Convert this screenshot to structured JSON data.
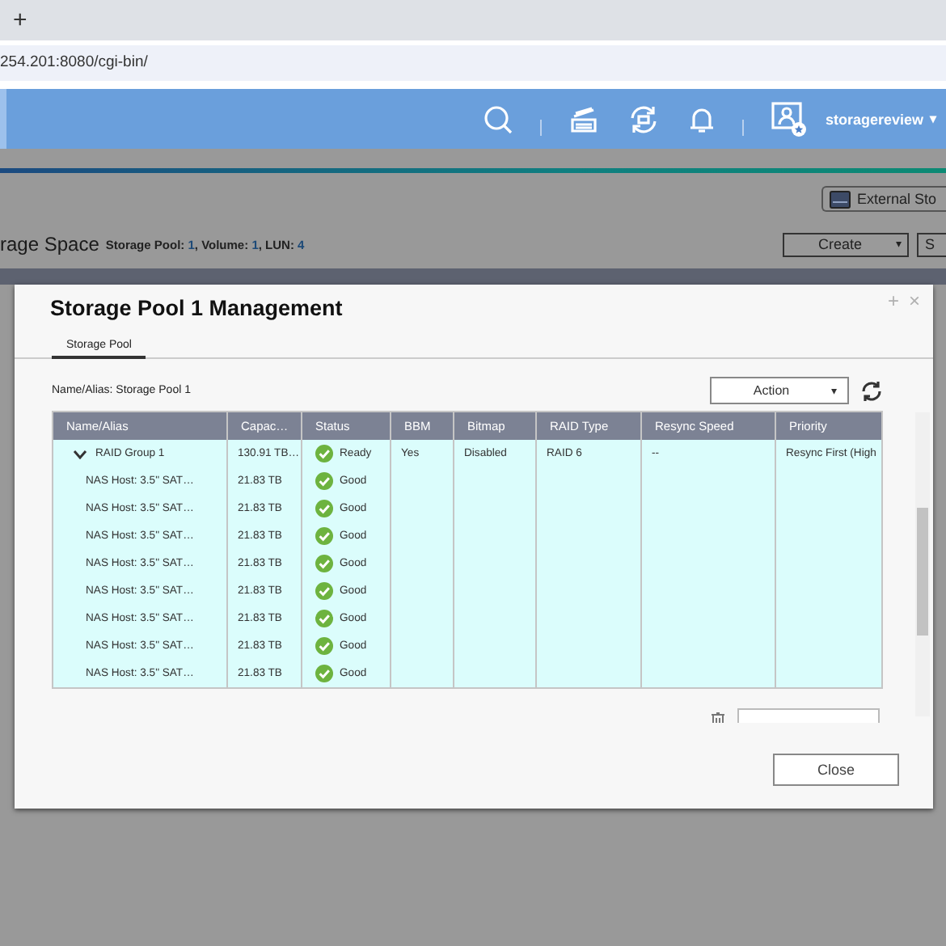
{
  "browser": {
    "new_tab": "+",
    "address": "254.201:8080/cgi-bin/"
  },
  "header": {
    "username": "storagereview",
    "menu_caret": "▾"
  },
  "background": {
    "external_button": "External Sto",
    "page_title": "rage Space",
    "summary": [
      {
        "label": "Storage Pool: ",
        "value": "1"
      },
      {
        "label": ", Volume: ",
        "value": "1"
      },
      {
        "label": ", LUN: ",
        "value": "4"
      }
    ],
    "create_button": "Create",
    "caret": "▾",
    "second_button": "S"
  },
  "dialog": {
    "title": "Storage Pool 1 Management",
    "controls": [
      "+",
      "×"
    ],
    "tabs": [
      {
        "label": "Storage Pool",
        "selected": true
      }
    ],
    "name_alias": "Name/Alias: Storage Pool 1",
    "action": "Action",
    "action_caret": "▾",
    "columns": [
      "Name/Alias",
      "Capac…",
      "Status",
      "BBM",
      "Bitmap",
      "RAID Type",
      "Resync Speed",
      "Priority"
    ],
    "rows": [
      {
        "name": "RAID Group 1",
        "capacity": "130.91 TB…",
        "status": "Ready",
        "bbm": "Yes",
        "bitmap": "Disabled",
        "raid_type": "RAID 6",
        "resync_speed": "--",
        "priority": "Resync First (High",
        "expanded": true,
        "children": [
          {
            "name": "NAS Host: 3.5\" SAT…",
            "capacity": "21.83 TB",
            "status": "Good"
          },
          {
            "name": "NAS Host: 3.5\" SAT…",
            "capacity": "21.83 TB",
            "status": "Good"
          },
          {
            "name": "NAS Host: 3.5\" SAT…",
            "capacity": "21.83 TB",
            "status": "Good"
          },
          {
            "name": "NAS Host: 3.5\" SAT…",
            "capacity": "21.83 TB",
            "status": "Good"
          },
          {
            "name": "NAS Host: 3.5\" SAT…",
            "capacity": "21.83 TB",
            "status": "Good"
          },
          {
            "name": "NAS Host: 3.5\" SAT…",
            "capacity": "21.83 TB",
            "status": "Good"
          },
          {
            "name": "NAS Host: 3.5\" SAT…",
            "capacity": "21.83 TB",
            "status": "Good"
          },
          {
            "name": "NAS Host: 3.5\" SAT…",
            "capacity": "21.83 TB",
            "status": "Good"
          }
        ]
      }
    ],
    "close_button": "Close"
  }
}
